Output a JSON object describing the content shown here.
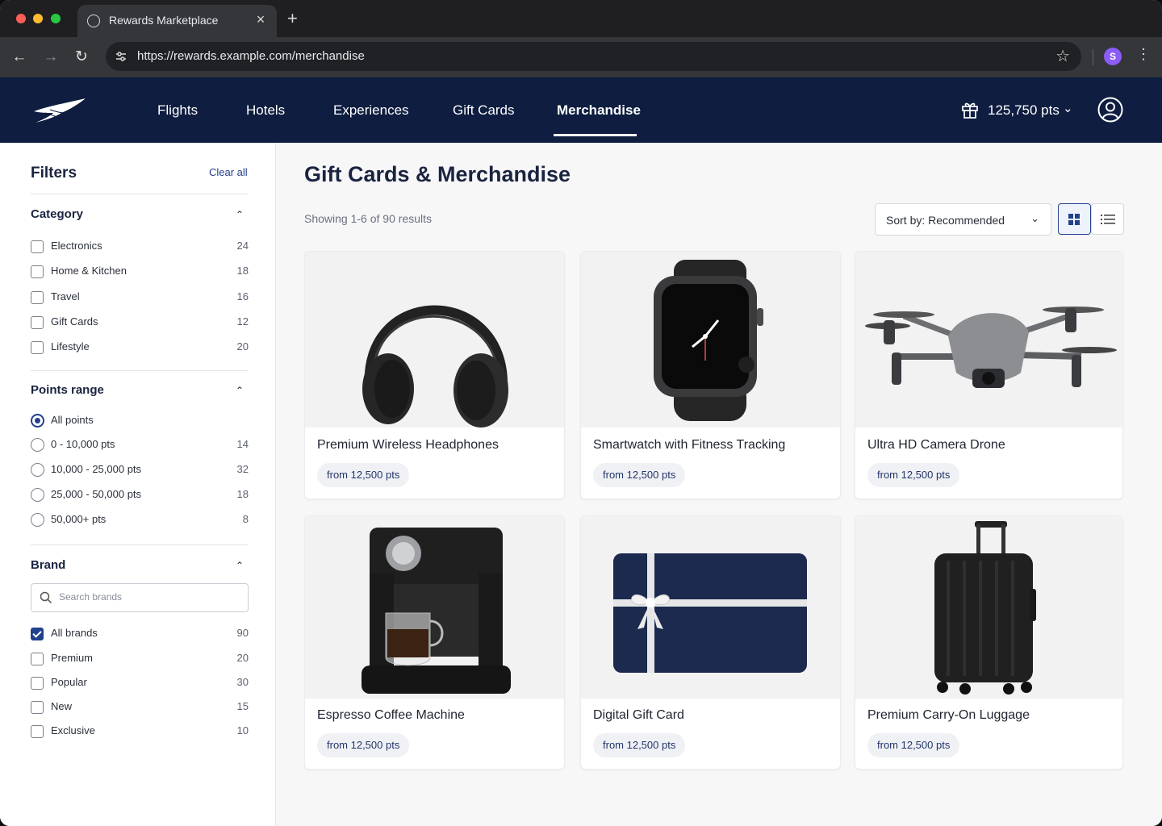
{
  "browser": {
    "tab_title": "Rewards Marketplace",
    "url": "https://rewards.example.com/merchandise",
    "profile_initial": "S",
    "icons": [
      "back-arrow-icon",
      "forward-arrow-icon",
      "reload-icon",
      "site-settings-icon",
      "star-icon",
      "kebab-menu-icon"
    ]
  },
  "header": {
    "nav": [
      "Flights",
      "Hotels",
      "Experiences",
      "Gift Cards",
      "Merchandise"
    ],
    "active_nav": "Merchandise",
    "points_balance": "125,750 pts",
    "brand_color": "#0e1d40"
  },
  "filters": {
    "title": "Filters",
    "clear_all": "Clear all",
    "category": {
      "title": "Category",
      "options": [
        {
          "label": "Electronics",
          "count": "24",
          "checked": false
        },
        {
          "label": "Home & Kitchen",
          "count": "18",
          "checked": false
        },
        {
          "label": "Travel",
          "count": "16",
          "checked": false
        },
        {
          "label": "Gift Cards",
          "count": "12",
          "checked": false
        },
        {
          "label": "Lifestyle",
          "count": "20",
          "checked": false
        }
      ]
    },
    "points_range": {
      "title": "Points range",
      "options": [
        {
          "label": "All points",
          "count": "",
          "selected": true
        },
        {
          "label": "0 - 10,000 pts",
          "count": "14",
          "selected": false
        },
        {
          "label": "10,000 - 25,000 pts",
          "count": "32",
          "selected": false
        },
        {
          "label": "25,000 - 50,000 pts",
          "count": "18",
          "selected": false
        },
        {
          "label": "50,000+ pts",
          "count": "8",
          "selected": false
        }
      ]
    },
    "brand": {
      "title": "Brand",
      "search_placeholder": "Search brands",
      "options": [
        {
          "label": "All brands",
          "count": "90",
          "checked": true
        },
        {
          "label": "Premium",
          "count": "20",
          "checked": false
        },
        {
          "label": "Popular",
          "count": "30",
          "checked": false
        },
        {
          "label": "New",
          "count": "15",
          "checked": false
        },
        {
          "label": "Exclusive",
          "count": "10",
          "checked": false
        }
      ]
    }
  },
  "main": {
    "title": "Gift Cards & Merchandise",
    "results": "Showing 1-6 of 90 results",
    "sort_label": "Sort by: Recommended",
    "view_mode": "grid",
    "accent_color": "#22408c",
    "products": [
      {
        "name": "Premium Wireless Headphones",
        "price": "from 12,500 pts",
        "image": "headphones"
      },
      {
        "name": "Smartwatch with Fitness Tracking",
        "price": "from 12,500 pts",
        "image": "smartwatch"
      },
      {
        "name": "Ultra HD Camera Drone",
        "price": "from 12,500 pts",
        "image": "drone"
      },
      {
        "name": "Espresso Coffee Machine",
        "price": "from 12,500 pts",
        "image": "espresso-machine"
      },
      {
        "name": "Digital Gift Card",
        "price": "from 12,500 pts",
        "image": "gift-card"
      },
      {
        "name": "Premium Carry-On Luggage",
        "price": "from 12,500 pts",
        "image": "luggage"
      }
    ]
  }
}
